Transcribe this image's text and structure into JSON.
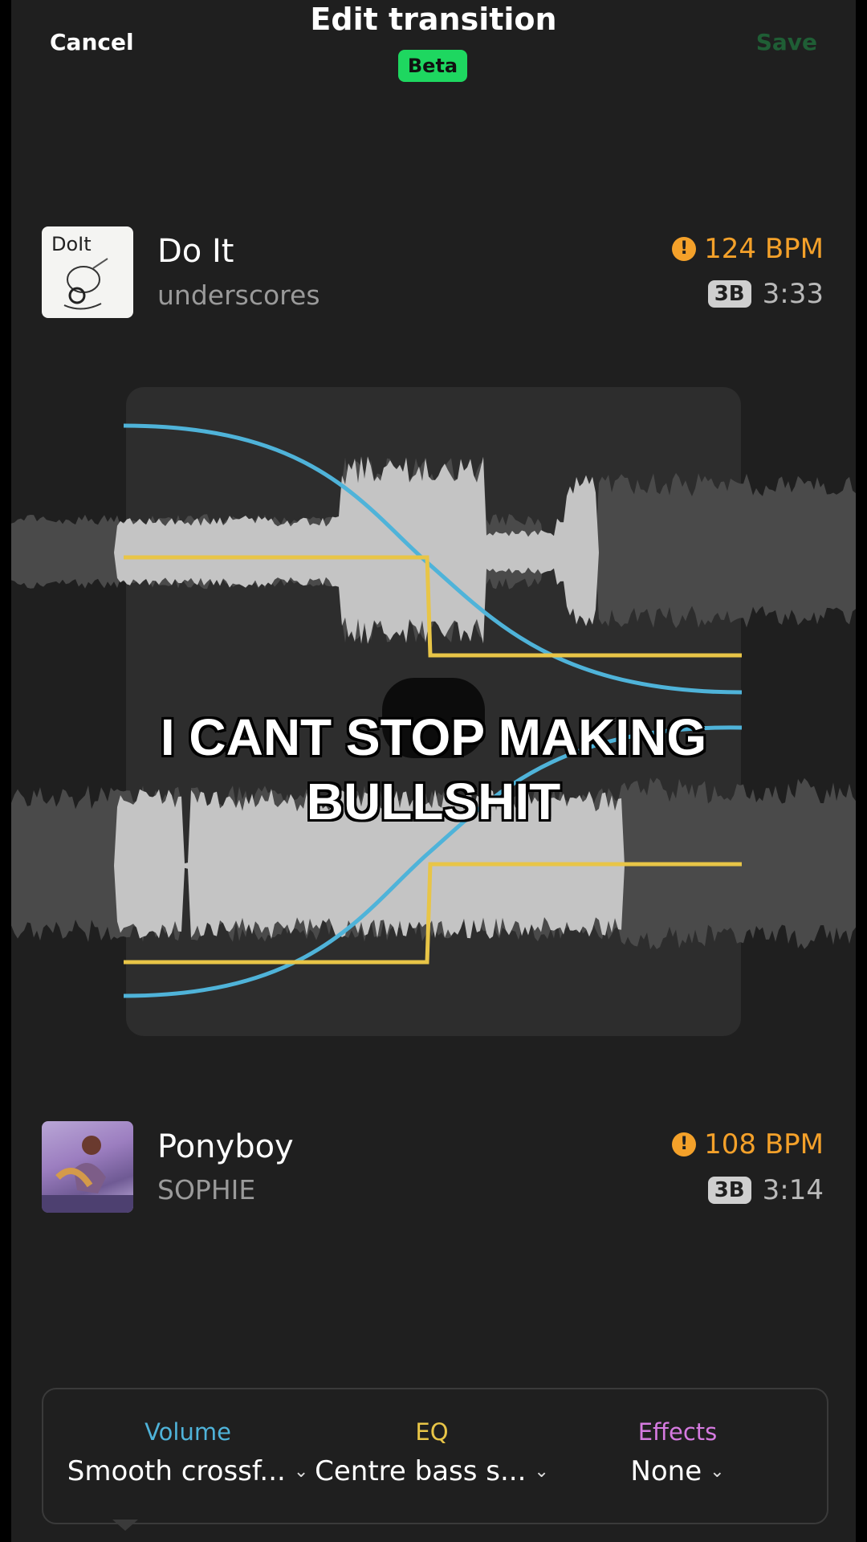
{
  "header": {
    "cancel_label": "Cancel",
    "title": "Edit transition",
    "badge": "Beta",
    "save_label": "Save"
  },
  "tracks": [
    {
      "title": "Do It",
      "artist": "underscores",
      "bpm": "124 BPM",
      "key": "3B",
      "duration": "3:33",
      "art_text": "DoIt"
    },
    {
      "title": "Ponyboy",
      "artist": "SOPHIE",
      "bpm": "108 BPM",
      "key": "3B",
      "duration": "3:14"
    }
  ],
  "caption": {
    "line1": "I CANT STOP MAKING",
    "line2": "BULLSHIT"
  },
  "controls": {
    "volume": {
      "label": "Volume",
      "value": "Smooth crossf...",
      "color": "#4fb3d9"
    },
    "eq": {
      "label": "EQ",
      "value": "Centre bass s...",
      "color": "#e8c547"
    },
    "effects": {
      "label": "Effects",
      "value": "None",
      "color": "#d57ae0"
    }
  },
  "colors": {
    "accent": "#1ed760",
    "warning": "#f4a12a",
    "volume_curve": "#4fb3d9",
    "eq_line": "#e8c547"
  }
}
